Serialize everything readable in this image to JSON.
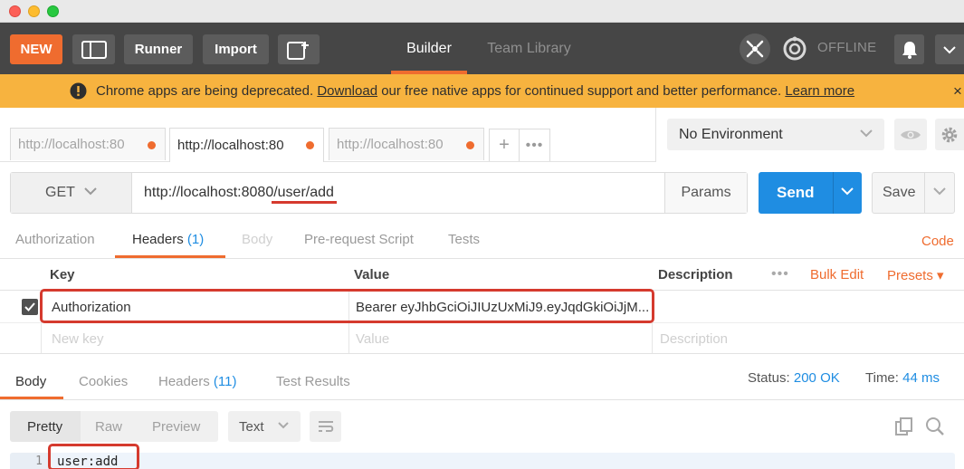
{
  "toolbar": {
    "new_label": "NEW",
    "runner_label": "Runner",
    "import_label": "Import",
    "builder_label": "Builder",
    "team_library_label": "Team Library",
    "offline_label": "OFFLINE"
  },
  "banner": {
    "text_before": "Chrome apps are being deprecated. ",
    "download_link": "Download",
    "text_after": " our free native apps for continued support and better performance. ",
    "learn_more_link": "Learn more",
    "close": "×"
  },
  "request_tabs": [
    {
      "label": "http://localhost:80"
    },
    {
      "label": "http://localhost:80"
    },
    {
      "label": "http://localhost:80"
    }
  ],
  "tab_add": "+",
  "tab_more": "•••",
  "environment": {
    "selected": "No Environment"
  },
  "request": {
    "method": "GET",
    "url": "http://localhost:8080/user/add",
    "params_label": "Params",
    "send_label": "Send",
    "save_label": "Save"
  },
  "request_subtabs": {
    "authorization": "Authorization",
    "headers": "Headers",
    "headers_count": "(1)",
    "body": "Body",
    "prerequest": "Pre-request Script",
    "tests": "Tests",
    "code": "Code"
  },
  "headers_table": {
    "col_key": "Key",
    "col_value": "Value",
    "col_description": "Description",
    "more": "•••",
    "bulk_edit": "Bulk Edit",
    "presets": "Presets ▾",
    "rows": [
      {
        "key": "Authorization",
        "value": "Bearer eyJhbGciOiJIUzUxMiJ9.eyJqdGkiOiJjM...",
        "enabled": true
      }
    ],
    "new_key_placeholder": "New key",
    "value_placeholder": "Value",
    "description_placeholder": "Description"
  },
  "response_tabs": {
    "body": "Body",
    "cookies": "Cookies",
    "headers": "Headers",
    "headers_count": "(11)",
    "test_results": "Test Results"
  },
  "response_status": {
    "status_label": "Status:",
    "status_value": "200 OK",
    "time_label": "Time:",
    "time_value": "44 ms"
  },
  "response_format": {
    "pretty": "Pretty",
    "raw": "Raw",
    "preview": "Preview",
    "type": "Text"
  },
  "response_body": {
    "line_number": "1",
    "line": "user:add"
  },
  "colors": {
    "accent": "#ef6c2f",
    "send": "#1f8de2",
    "banner": "#f7b33f",
    "highlight": "#d53a2e"
  }
}
